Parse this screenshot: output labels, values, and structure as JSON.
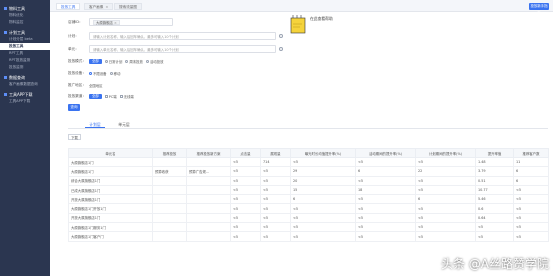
{
  "sidebar": {
    "sections": [
      {
        "title": "物料工具",
        "items": [
          "物料优化",
          "物料监控"
        ]
      },
      {
        "title": "计划工具",
        "items": [
          "计划分层 beta",
          "投放工具",
          "RPT工具",
          "RPT投放监测",
          "投放监测"
        ]
      },
      {
        "title": "数据查询",
        "items": [
          "客户画像数据查询"
        ]
      },
      {
        "title": "工具APP下载",
        "items": [
          "工具APP下载"
        ]
      }
    ],
    "active_item": "投放工具"
  },
  "tabs": [
    {
      "label": "投放工具",
      "active": true
    },
    {
      "label": "客户画像",
      "active": false
    },
    {
      "label": "搜索流量图",
      "active": false
    }
  ],
  "help_button": "投放新手指南",
  "filters": {
    "shop_label": "店铺ID：",
    "shop_tag": "大原旗舰店",
    "plan_label": "计划：",
    "plan_placeholder": "请输入计划名称，输入后回车确认，最多可输入10个计划",
    "unit_label": "单元：",
    "unit_placeholder": "请输入单元名称，输入后回车确认，最多可输入10个计划",
    "mode_label": "投放模式：",
    "mode_button": "全部",
    "mode_options": [
      "日常计划",
      "周末投放",
      "活动投放"
    ],
    "device_label": "投放设备：",
    "device_options": [
      "不限设备",
      "移动"
    ],
    "area_label": "推广地区：",
    "area_value": "全国地区",
    "channel_label": "投放渠道：",
    "channel_button": "全部",
    "channel_options": [
      "PC端",
      "无线端"
    ],
    "query_button": "查询"
  },
  "note_text": "在此查看帮助",
  "subtabs": [
    "计划层",
    "单元层"
  ],
  "export_button": "下载",
  "table": {
    "headers": [
      "单元名",
      "推荐投放",
      "推荐投放新方案",
      "点击量",
      "展现量",
      "曝光时长均值提升率(%)",
      "活动期间的提升率(%)",
      "计划期间的提升率(%)",
      "提升率值",
      "推荐客户数"
    ],
    "rows": [
      [
        "大原旗舰店1门",
        "",
        "",
        "<5",
        "714",
        "<5",
        "<5",
        "<5",
        "1.48",
        "11"
      ],
      [
        "大原旗舰店1门",
        "预算收获",
        "预算广告规...",
        "<5",
        "<5",
        "29",
        "6",
        "22",
        "3.79",
        "6"
      ],
      [
        "综合大原旗舰店1门",
        "",
        "",
        "<5",
        "<5",
        "20",
        "<5",
        "<5",
        "0.51",
        "6"
      ],
      [
        "已成大原旗舰店1门",
        "",
        "",
        "<5",
        "<5",
        "15",
        "18",
        "<5",
        "10.77",
        "<5"
      ],
      [
        "开放大原旗舰店1门",
        "",
        "",
        "<5",
        "<5",
        "6",
        "<5",
        "6",
        "5.46",
        "<5"
      ],
      [
        "大原旗舰店1门开放1门",
        "",
        "",
        "<5",
        "<5",
        "<5",
        "<5",
        "<5",
        "0.6",
        "<5"
      ],
      [
        "开放大原旗舰店1门",
        "",
        "",
        "<5",
        "<5",
        "<5",
        "<5",
        "<5",
        "0.64",
        "<5"
      ],
      [
        "大原旗舰店1门服务1门",
        "",
        "",
        "<5",
        "<5",
        "<5",
        "<5",
        "<5",
        "<5",
        "<5"
      ],
      [
        "大原旗舰店1门客户门",
        "",
        "",
        "<5",
        "<5",
        "<5",
        "<5",
        "<5",
        "<5",
        "<5"
      ]
    ]
  },
  "watermark": "头条 @A丝路赞学院"
}
